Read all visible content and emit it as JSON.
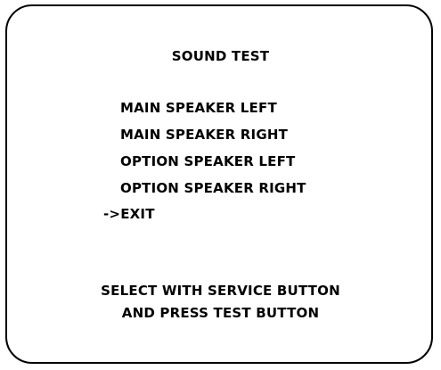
{
  "screen": {
    "title": "SOUND TEST",
    "menu": {
      "items": [
        {
          "label": "MAIN SPEAKER LEFT"
        },
        {
          "label": "MAIN SPEAKER RIGHT"
        },
        {
          "label": "OPTION SPEAKER LEFT"
        },
        {
          "label": "OPTION SPEAKER RIGHT"
        },
        {
          "label": "EXIT",
          "cursor": "->"
        }
      ]
    },
    "footer": {
      "line_1": "SELECT WITH SERVICE BUTTON",
      "line_2": "AND PRESS TEST BUTTON"
    }
  },
  "colors": {
    "background": "#ffffff",
    "text": "#000000",
    "frame": "#000000"
  }
}
